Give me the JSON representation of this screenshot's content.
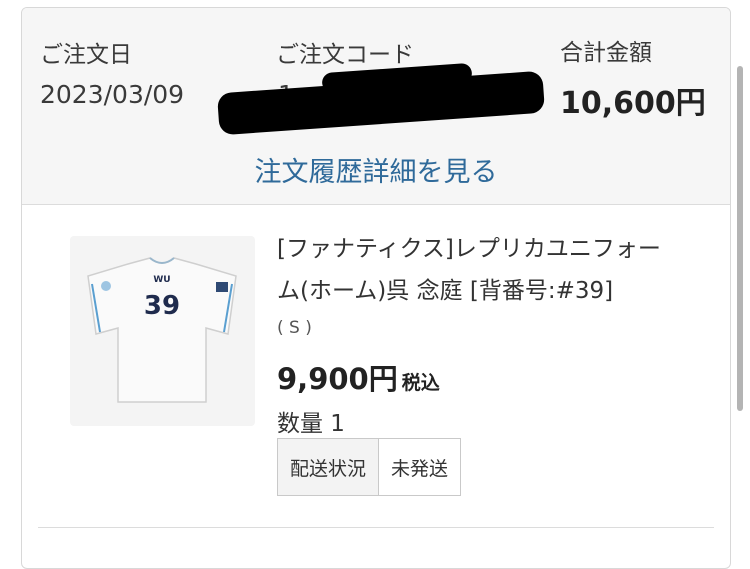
{
  "order": {
    "date_label": "ご注文日",
    "date_value": "2023/03/09",
    "code_label": "ご注文コード",
    "code_visible_start": "1",
    "total_label": "合計金額",
    "total_value": "10,600円",
    "detail_link": "注文履歴詳細を見る"
  },
  "item": {
    "jersey_name": "WU",
    "jersey_number": "39",
    "name_line1": "[ファナティクス]レプリカユニフォー",
    "name_line2": "ム(ホーム)呉 念庭 [背番号:#39]",
    "size": "( S )",
    "price": "9,900円",
    "tax_label": "税込",
    "quantity": "数量 1",
    "shipping_label": "配送状況",
    "shipping_status": "未発送"
  },
  "colors": {
    "link": "#2f6a9a",
    "summary_bg": "#f6f6f6",
    "jersey_trim": "#5a9fd0",
    "jersey_number": "#1f2b4d"
  }
}
